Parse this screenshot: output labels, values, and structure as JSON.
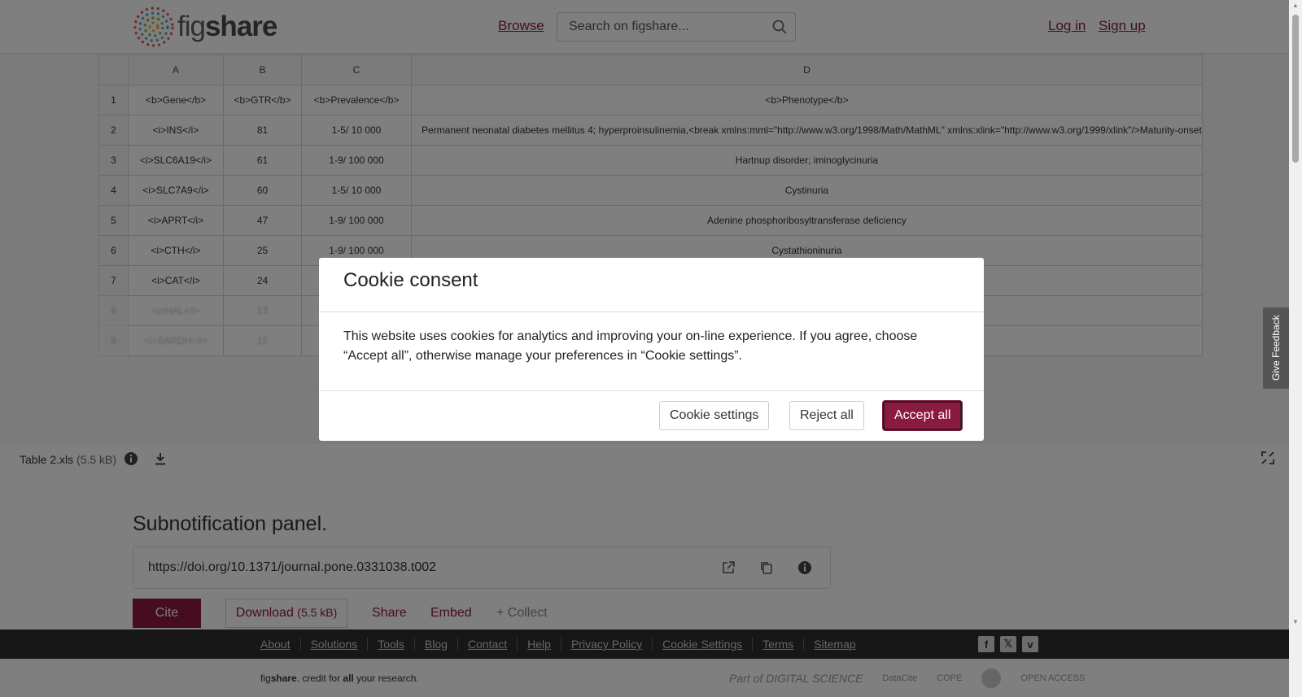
{
  "header": {
    "logo_fig": "fig",
    "logo_share": "share",
    "browse": "Browse",
    "search_placeholder": "Search on figshare...",
    "login": "Log in",
    "signup": "Sign up"
  },
  "sheet": {
    "columns": [
      "A",
      "B",
      "C",
      "D"
    ],
    "rows": [
      [
        "1",
        "<b>Gene</b>",
        "<b>GTR</b>",
        "<b>Prevalence</b>",
        "<b>Phenotype</b>"
      ],
      [
        "2",
        "<i>INS</i>",
        "81",
        "1-5/ 10 000",
        "Permanent neonatal diabetes mellitus 4; hyperproinsulinemia,<break xmlns:mml=\"http://www.w3.org/1998/Math/MathML\" xmlns:xlink=\"http://www.w3.org/1999/xlink\"/>Maturity-onset"
      ],
      [
        "3",
        "<i>SLC6A19</i>",
        "61",
        "1-9/ 100 000",
        "Hartnup disorder; iminoglycinuria"
      ],
      [
        "4",
        "<i>SLC7A9</i>",
        "60",
        "1-5/ 10 000",
        "Cystinuria"
      ],
      [
        "5",
        "<i>APRT</i>",
        "47",
        "1-9/ 100 000",
        "Adenine phosphoribosyltransferase deficiency"
      ],
      [
        "6",
        "<i>CTH</i>",
        "25",
        "1-9/ 100 000",
        "Cystathioninuria"
      ],
      [
        "7",
        "<i>CAT</i>",
        "24",
        "",
        ""
      ],
      [
        "8",
        "<i>HAL</i>",
        "13",
        "",
        ""
      ],
      [
        "9",
        "<i>SARDH</i>",
        "12",
        "",
        ""
      ]
    ]
  },
  "file": {
    "name": "Table 2.xls",
    "size": "(5.5 kB)"
  },
  "main": {
    "title": "Subnotification panel.",
    "doi": "https://doi.org/10.1371/journal.pone.0331038.t002",
    "cite": "Cite",
    "download": "Download",
    "download_size": "(5.5 kB)",
    "share": "Share",
    "embed": "Embed",
    "collect": "+ Collect"
  },
  "footer": {
    "links": [
      "About",
      "Solutions",
      "Tools",
      "Blog",
      "Contact",
      "Help",
      "Privacy Policy",
      "Cookie Settings",
      "Terms",
      "Sitemap"
    ],
    "tag_pre": "fig",
    "tag_brand": "share",
    "tag_mid": ". credit for ",
    "tag_all": "all",
    "tag_end": " your research.",
    "partner_ds": "Part of DIGITAL SCIENCE",
    "partner_datacite": "DataCite",
    "partner_cope": "COPE",
    "partner_oa": "OPEN ACCESS"
  },
  "feedback": "Give Feedback",
  "modal": {
    "title": "Cookie consent",
    "body": "This website uses cookies for analytics and improving your on-line experience. If you agree, choose “Accept all”, otherwise manage your preferences in “Cookie settings”.",
    "settings": "Cookie settings",
    "reject": "Reject all",
    "accept": "Accept all"
  },
  "colors": {
    "brand": "#8a1a3e",
    "footer_bg": "#2f2f2f"
  }
}
